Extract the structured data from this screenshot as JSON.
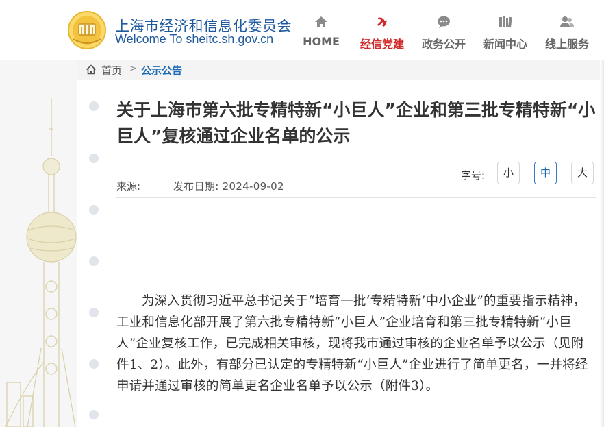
{
  "header": {
    "title_cn": "上海市经济和信息化委员会",
    "title_en": "Welcome To sheitc.sh.gov.cn",
    "nav": [
      {
        "label": "HOME",
        "icon": "home-icon"
      },
      {
        "label": "经信党建",
        "icon": "party-emblem-icon",
        "active": true
      },
      {
        "label": "政务公开",
        "icon": "chat-bubble-icon"
      },
      {
        "label": "新闻中心",
        "icon": "books-icon"
      },
      {
        "label": "线上服务",
        "icon": "user-group-icon"
      }
    ]
  },
  "breadcrumb": {
    "home": "首页",
    "separator": ">",
    "current": "公示公告"
  },
  "article": {
    "title": "关于上海市第六批专精特新“小巨人”企业和第三批专精特新“小巨人”复核通过企业名单的公示",
    "font_size_label": "字号:",
    "font_sizes": [
      "小",
      "中",
      "大"
    ],
    "font_size_selected": "中",
    "source_label": "来源:",
    "date_label": "发布日期:",
    "date": "2024-09-02",
    "body": "为深入贯彻习近平总书记关于“培育一批‘专精特新’中小企业”的重要指示精神，工业和信息化部开展了第六批专精特新“小巨人”企业培育和第三批专精特新“小巨人”企业复核工作，已完成相关审核，现将我市通过审核的企业名单予以公示（见附件1、2）。此外，有部分已认定的专精特新“小巨人”企业进行了简单更名，一并将经申请并通过审核的简单更名企业名单予以公示（附件3）。"
  },
  "colors": {
    "brand_blue": "#1f5a9e",
    "link_blue": "#1f6cb6",
    "active_red": "#d22a2a",
    "logo_gold": "#e8b730"
  }
}
